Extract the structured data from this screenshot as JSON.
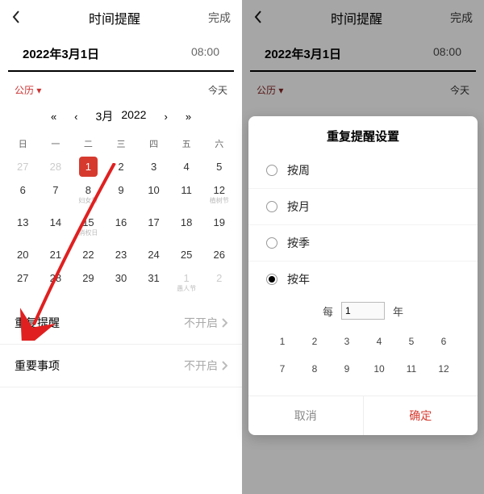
{
  "left": {
    "topbar": {
      "title": "时间提醒",
      "done": "完成"
    },
    "date_row": {
      "date": "2022年3月1日",
      "time": "08:00"
    },
    "cal_head": {
      "type": "公历 ▾",
      "today": "今天"
    },
    "month_nav": {
      "first": "«",
      "prev": "‹",
      "month": "3月",
      "year": "2022",
      "next": "›",
      "last": "»"
    },
    "weekdays": [
      "日",
      "一",
      "二",
      "三",
      "四",
      "五",
      "六"
    ],
    "grid": [
      {
        "n": "27",
        "dim": true
      },
      {
        "n": "28",
        "dim": true
      },
      {
        "n": "1",
        "sel": true
      },
      {
        "n": "2"
      },
      {
        "n": "3"
      },
      {
        "n": "4"
      },
      {
        "n": "5"
      },
      {
        "n": "6"
      },
      {
        "n": "7"
      },
      {
        "n": "8",
        "sub": "妇女节"
      },
      {
        "n": "9"
      },
      {
        "n": "10"
      },
      {
        "n": "11"
      },
      {
        "n": "12",
        "sub": "植树节"
      },
      {
        "n": "13"
      },
      {
        "n": "14"
      },
      {
        "n": "15",
        "sub": "消权日"
      },
      {
        "n": "16"
      },
      {
        "n": "17"
      },
      {
        "n": "18"
      },
      {
        "n": "19"
      },
      {
        "n": "20"
      },
      {
        "n": "21"
      },
      {
        "n": "22"
      },
      {
        "n": "23"
      },
      {
        "n": "24"
      },
      {
        "n": "25"
      },
      {
        "n": "26"
      },
      {
        "n": "27"
      },
      {
        "n": "28"
      },
      {
        "n": "29"
      },
      {
        "n": "30"
      },
      {
        "n": "31"
      },
      {
        "n": "1",
        "dim": true,
        "sub": "愚人节"
      },
      {
        "n": "2",
        "dim": true
      }
    ],
    "rows": {
      "repeat": {
        "label": "重复提醒",
        "value": "不开启"
      },
      "important": {
        "label": "重要事项",
        "value": "不开启"
      }
    }
  },
  "right": {
    "topbar": {
      "title": "时间提醒",
      "done": "完成"
    },
    "date_row": {
      "date": "2022年3月1日",
      "time": "08:00"
    },
    "cal_head": {
      "type": "公历 ▾",
      "today": "今天"
    },
    "modal": {
      "title": "重复提醒设置",
      "options": {
        "weekly": "按周",
        "monthly": "按月",
        "quarterly": "按季",
        "yearly": "按年"
      },
      "every_prefix": "每",
      "every_value": "1",
      "every_suffix": "年",
      "months": [
        "1",
        "2",
        "3",
        "4",
        "5",
        "6",
        "7",
        "8",
        "9",
        "10",
        "11",
        "12"
      ],
      "cancel": "取消",
      "confirm": "确定"
    }
  }
}
